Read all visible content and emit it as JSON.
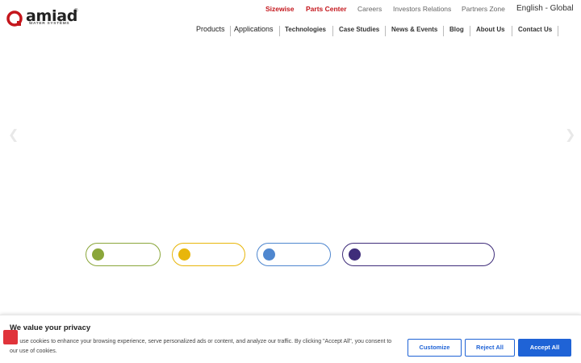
{
  "brand": {
    "name": "amiad",
    "tagline": "WATER SYSTEMS",
    "registered": "®",
    "color": "#c4161c"
  },
  "top_nav": {
    "sizewise": "Sizewise",
    "parts_center": "Parts Center",
    "careers": "Careers",
    "investors": "Investors Relations",
    "partners": "Partners Zone",
    "language": "English - Global"
  },
  "main_nav": {
    "products": "Products",
    "applications": "Applications",
    "technologies": "Technologies",
    "case_studies": "Case Studies",
    "news_events": "News & Events",
    "blog": "Blog",
    "about_us": "About Us",
    "contact_us": "Contact Us"
  },
  "slider": {
    "prev_icon": "chevron-left-icon",
    "next_icon": "chevron-right-icon"
  },
  "pills": [
    {
      "color": "#8aa63a"
    },
    {
      "color": "#e8b60b"
    },
    {
      "color": "#4f87cf"
    },
    {
      "color": "#3f2d7a"
    }
  ],
  "cookie": {
    "title": "We value your privacy",
    "text": "We use cookies to enhance your browsing experience, serve personalized ads or content, and analyze our traffic. By clicking \"Accept All\", you consent to our use of cookies.",
    "customize": "Customize",
    "reject": "Reject All",
    "accept": "Accept All",
    "accent": "#1f63d6"
  }
}
